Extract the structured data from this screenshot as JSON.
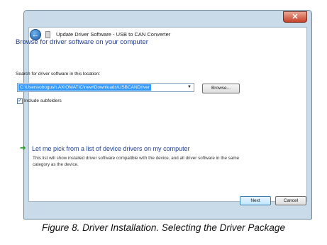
{
  "window": {
    "title": "Update Driver Software - USB to CAN Converter",
    "close_label": "✕"
  },
  "icons": {
    "back": "back-arrow-icon",
    "device": "usb-device-icon",
    "arrow": "green-arrow-icon"
  },
  "main": {
    "heading": "Browse for driver software on your computer",
    "search_label": "Search for driver software in this location:",
    "path_value": "C:\\Users\\obogush.AXIOMATIC\\new\\Downloads\\USBCANDriver",
    "browse_label": "Browse...",
    "include_subfolders_label": "Include subfolders",
    "include_subfolders_checked": true,
    "pick_link": "Let me pick from a list of device drivers on my computer",
    "pick_description": "This list will show installed driver software compatible with the device, and all driver software in the same category as the device."
  },
  "footer": {
    "next_label": "Next",
    "cancel_label": "Cancel"
  },
  "caption": "Figure 8. Driver Installation. Selecting the Driver Package",
  "colors": {
    "frame": "#c9dbe9",
    "heading": "#1f3f8f",
    "selection": "#3399ff",
    "arrow": "#2e9a2e"
  }
}
